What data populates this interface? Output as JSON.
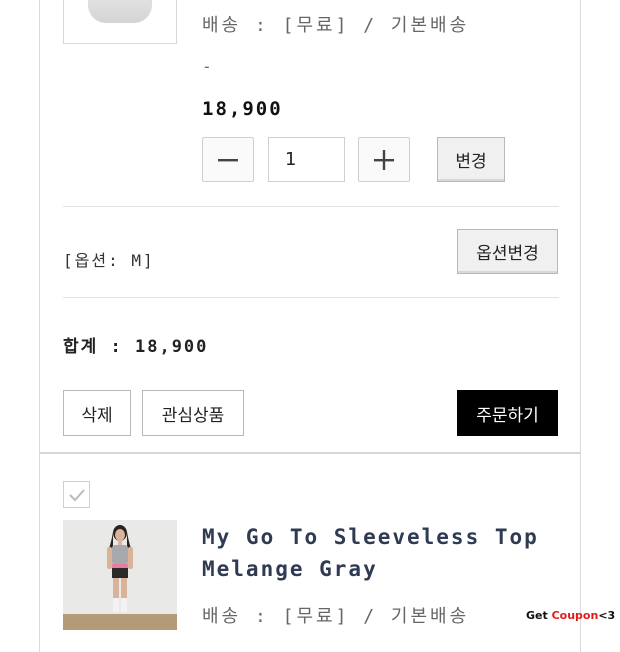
{
  "item1": {
    "shipping": "배송 : [무료] / 기본배송",
    "dash": "-",
    "price": "18,900",
    "quantity": "1",
    "change_label": "변경",
    "option_text": "[옵션: M]",
    "option_change_label": "옵션변경",
    "total_text": "합계 : 18,900",
    "delete_label": "삭제",
    "wishlist_label": "관심상품",
    "order_label": "주문하기"
  },
  "item2": {
    "name_line1": "My Go To Sleeveless Top",
    "name_line2": "Melange Gray",
    "shipping": "배송 : [무료] / 기본배송"
  },
  "coupon": {
    "prefix": "Get ",
    "highlight": "Coupon",
    "suffix": "<3"
  },
  "colors": {
    "accent": "#e01b1b",
    "primary_button": "#000000",
    "product_name": "#2f3b52"
  }
}
